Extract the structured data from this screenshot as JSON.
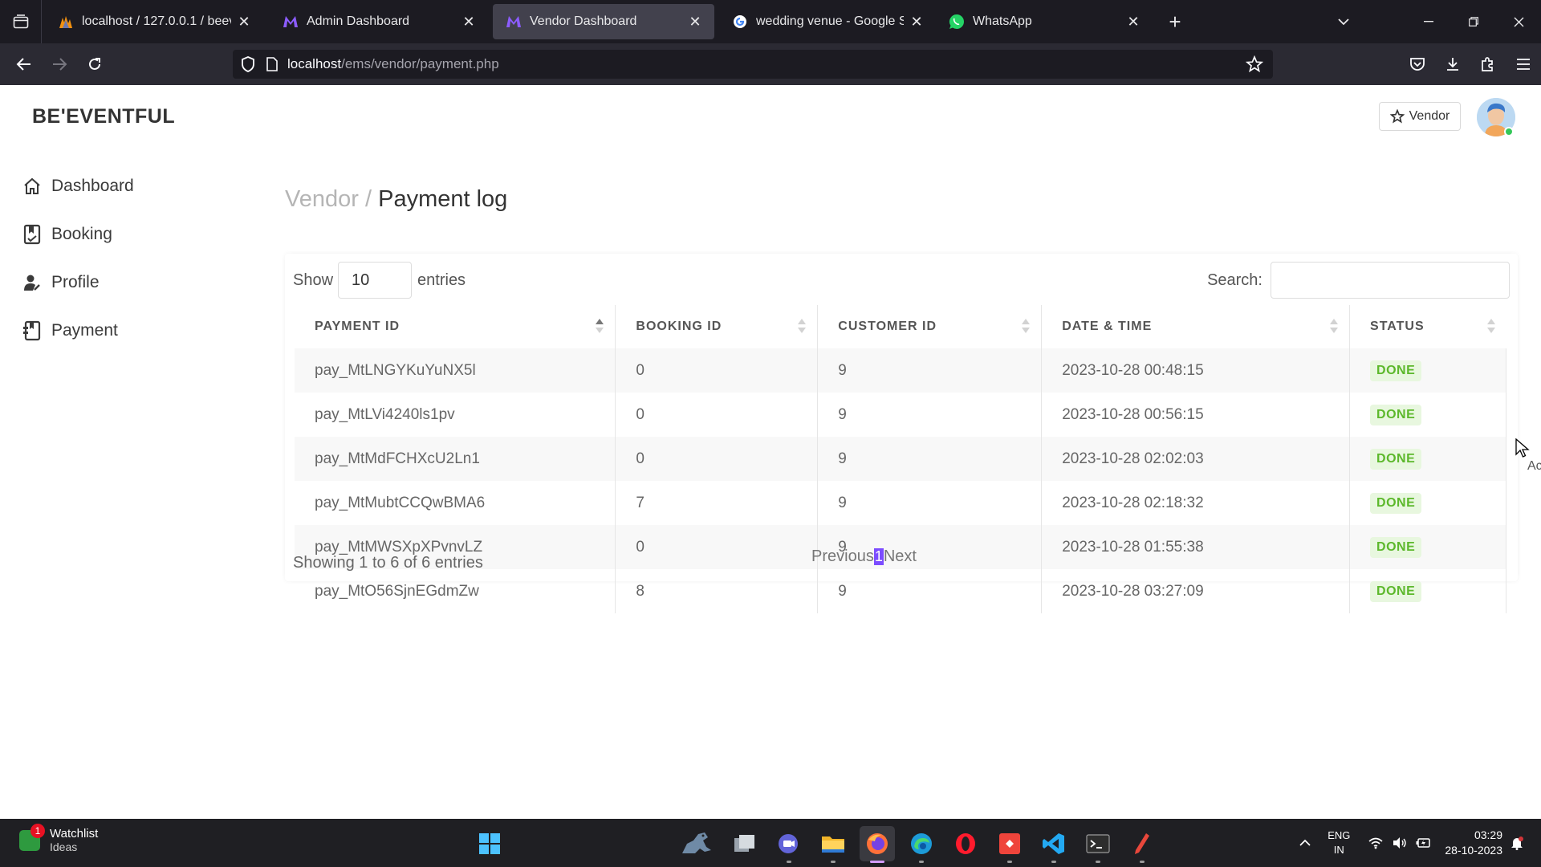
{
  "browser": {
    "tabs": [
      {
        "label": "localhost / 127.0.0.1 / beeventfu",
        "icon": "phpmyadmin-icon",
        "active": false
      },
      {
        "label": "Admin Dashboard",
        "icon": "m-logo-icon",
        "active": false
      },
      {
        "label": "Vendor Dashboard",
        "icon": "m-logo-icon",
        "active": true
      },
      {
        "label": "wedding venue - Google Search",
        "icon": "google-icon",
        "active": false
      },
      {
        "label": "WhatsApp",
        "icon": "whatsapp-icon",
        "active": false
      }
    ],
    "url_host": "localhost",
    "url_path": "/ems/vendor/payment.php"
  },
  "app": {
    "brand": "BE'EVENTFUL",
    "vendor_button": "Vendor",
    "sidebar": [
      {
        "label": "Dashboard",
        "icon": "home-icon"
      },
      {
        "label": "Booking",
        "icon": "bookmark-icon"
      },
      {
        "label": "Profile",
        "icon": "user-icon"
      },
      {
        "label": "Payment",
        "icon": "payment-icon"
      }
    ],
    "breadcrumb": {
      "parent": "Vendor",
      "separator": "/",
      "current": "Payment log"
    }
  },
  "table": {
    "show_label": "Show",
    "entries_value": "10",
    "entries_label": "entries",
    "search_label": "Search:",
    "search_value": "",
    "columns": [
      "PAYMENT ID",
      "BOOKING ID",
      "CUSTOMER ID",
      "DATE & TIME",
      "STATUS"
    ],
    "rows": [
      {
        "payment_id": "pay_MtLNGYKuYuNX5l",
        "booking_id": "0",
        "customer_id": "9",
        "datetime": "2023-10-28 00:48:15",
        "status": "DONE"
      },
      {
        "payment_id": "pay_MtLVi4240ls1pv",
        "booking_id": "0",
        "customer_id": "9",
        "datetime": "2023-10-28 00:56:15",
        "status": "DONE"
      },
      {
        "payment_id": "pay_MtMdFCHXcU2Ln1",
        "booking_id": "0",
        "customer_id": "9",
        "datetime": "2023-10-28 02:02:03",
        "status": "DONE"
      },
      {
        "payment_id": "pay_MtMubtCCQwBMA6",
        "booking_id": "7",
        "customer_id": "9",
        "datetime": "2023-10-28 02:18:32",
        "status": "DONE"
      },
      {
        "payment_id": "pay_MtMWSXpXPvnvLZ",
        "booking_id": "0",
        "customer_id": "9",
        "datetime": "2023-10-28 01:55:38",
        "status": "DONE"
      },
      {
        "payment_id": "pay_MtO56SjnEGdmZw",
        "booking_id": "8",
        "customer_id": "9",
        "datetime": "2023-10-28 03:27:09",
        "status": "DONE"
      }
    ],
    "info": "Showing 1 to 6 of 6 entries",
    "pagination": {
      "previous": "Previous",
      "current": "1",
      "next": "Next"
    }
  },
  "overlay_text": "Ac",
  "taskbar": {
    "widget_title": "Watchlist",
    "widget_subtitle": "Ideas",
    "widget_badge": "1",
    "language_line1": "ENG",
    "language_line2": "IN",
    "time": "03:29",
    "date": "28-10-2023"
  },
  "colors": {
    "accent": "#7c4dff",
    "status_done_bg": "#e8f7df",
    "status_done_text": "#5cb82b",
    "tabbar_bg": "#1c1b22",
    "taskbar_bg": "#1f1f23"
  }
}
